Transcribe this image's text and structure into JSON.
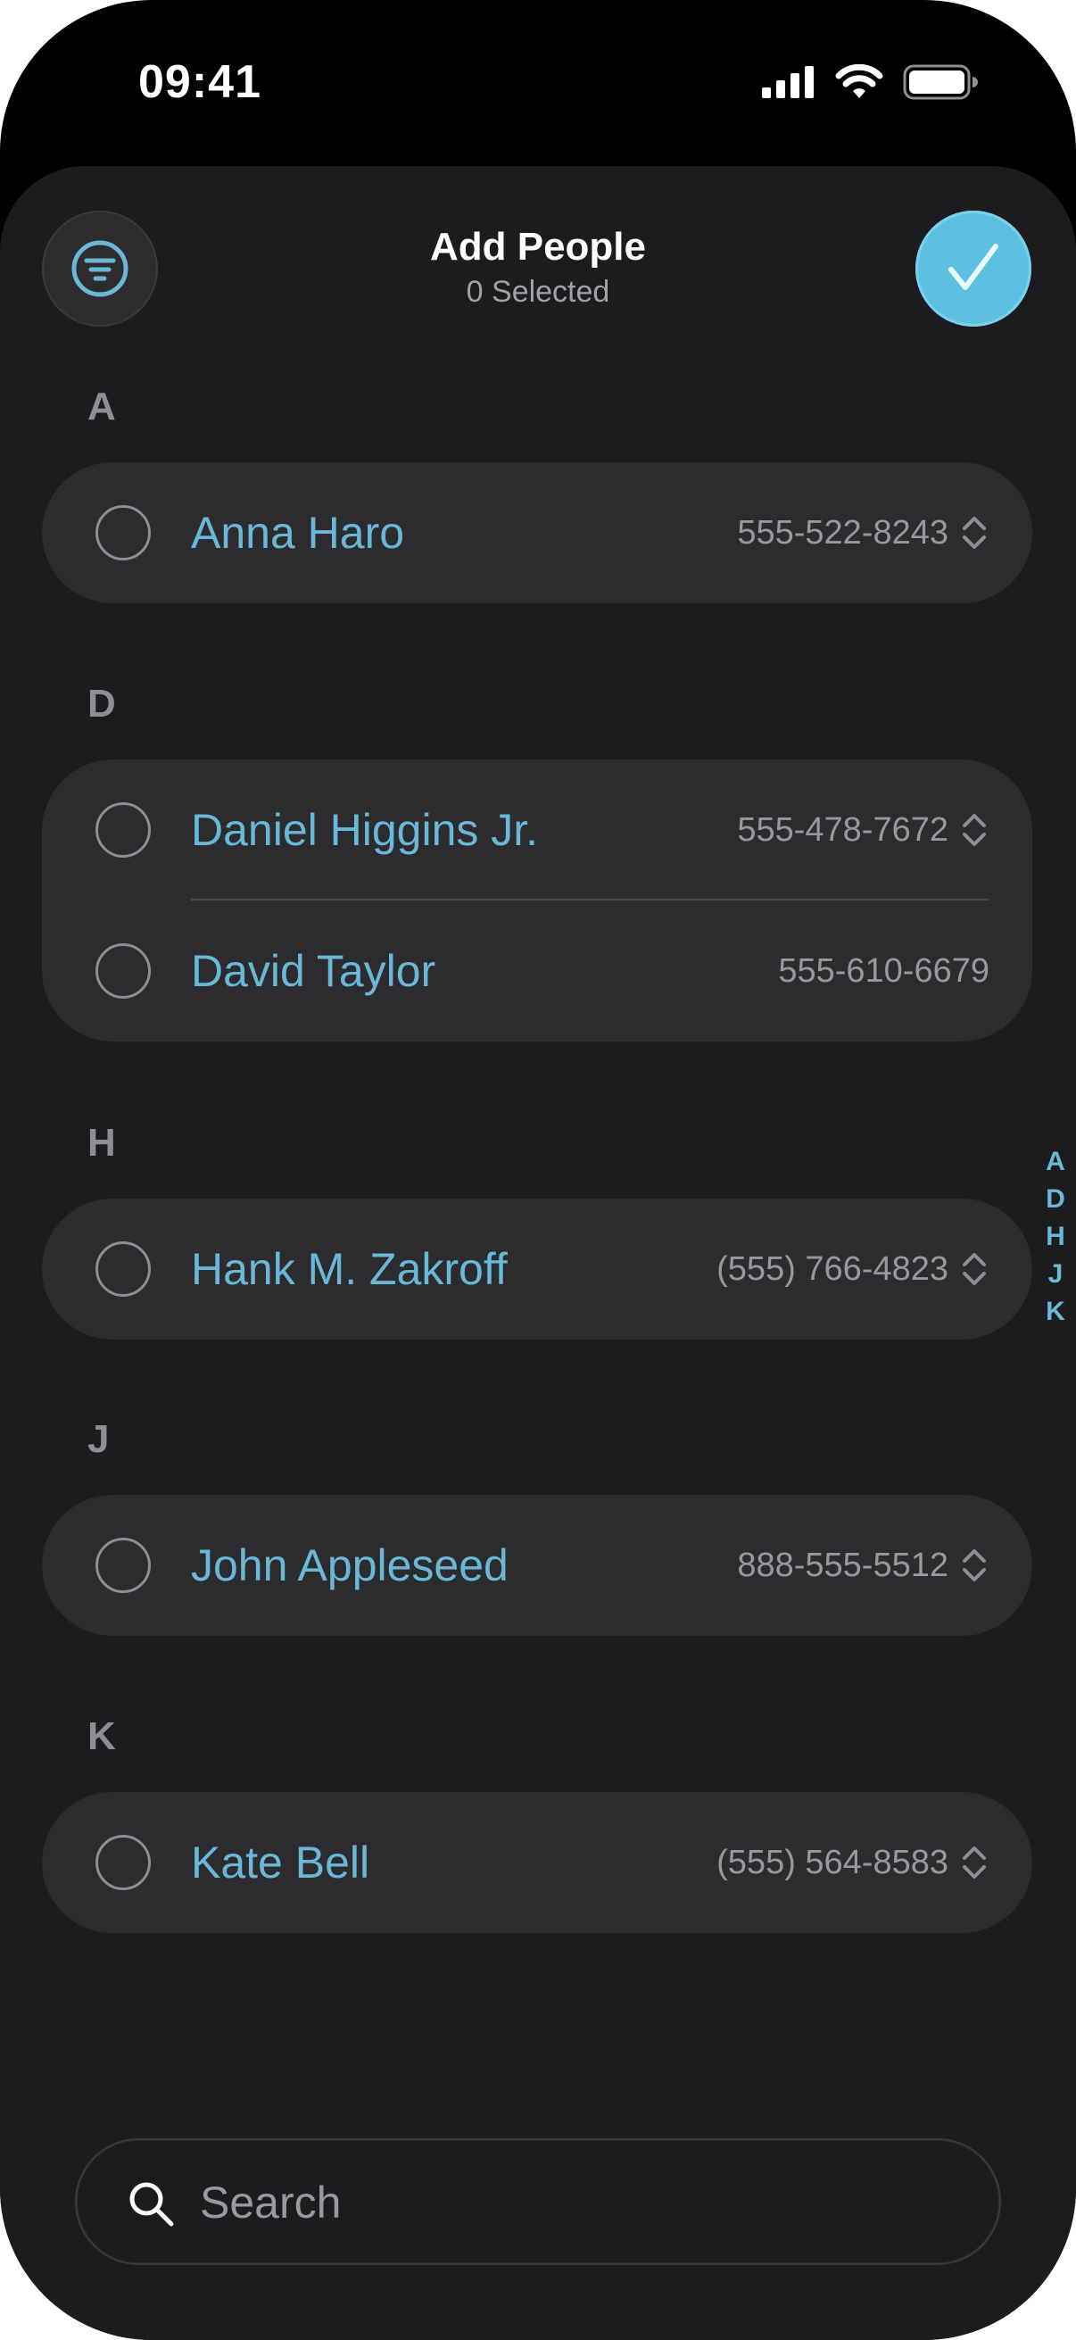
{
  "status_bar": {
    "time": "09:41"
  },
  "header": {
    "title": "Add People",
    "subtitle": "0 Selected",
    "filter_icon": "filter-icon",
    "done_icon": "checkmark-icon"
  },
  "sections": [
    {
      "letter": "A",
      "contacts": [
        {
          "name": "Anna Haro",
          "phone": "555-522-8243",
          "has_chevron": true,
          "selected": false
        }
      ]
    },
    {
      "letter": "D",
      "contacts": [
        {
          "name": "Daniel Higgins Jr.",
          "phone": "555-478-7672",
          "has_chevron": true,
          "selected": false
        },
        {
          "name": "David Taylor",
          "phone": "555-610-6679",
          "has_chevron": false,
          "selected": false
        }
      ]
    },
    {
      "letter": "H",
      "contacts": [
        {
          "name": "Hank M. Zakroff",
          "phone": "(555) 766-4823",
          "has_chevron": true,
          "selected": false
        }
      ]
    },
    {
      "letter": "J",
      "contacts": [
        {
          "name": "John Appleseed",
          "phone": "888-555-5512",
          "has_chevron": true,
          "selected": false
        }
      ]
    },
    {
      "letter": "K",
      "contacts": [
        {
          "name": "Kate Bell",
          "phone": "(555) 564-8583",
          "has_chevron": true,
          "selected": false
        }
      ]
    }
  ],
  "index_letters": [
    "A",
    "D",
    "H",
    "J",
    "K"
  ],
  "search": {
    "placeholder": "Search",
    "value": ""
  },
  "colors": {
    "accent": "#6ab8d8",
    "done_button": "#5ec0e0",
    "background": "#1c1c1e",
    "card": "#2c2c2e"
  }
}
